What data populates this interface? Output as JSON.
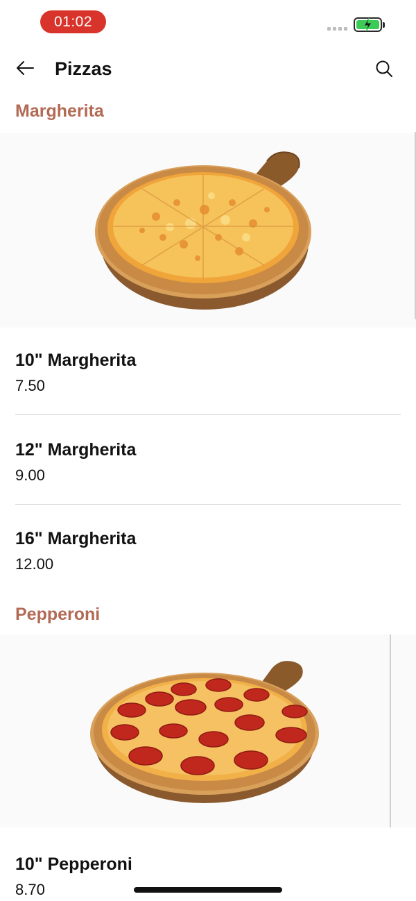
{
  "status_bar": {
    "time": "01:02",
    "time_pill_color": "#d8342c",
    "battery_color": "#3dcb57",
    "signal_icon": "signal-dots-icon",
    "battery_icon": "battery-charging-icon"
  },
  "header": {
    "title": "Pizzas",
    "back_icon": "arrow-left-icon",
    "search_icon": "search-icon"
  },
  "colors": {
    "category_title": "#b26a55",
    "divider": "#d4d4d4"
  },
  "categories": [
    {
      "title": "Margherita",
      "image": "margherita-pizza-image",
      "items": [
        {
          "name": "10\" Margherita",
          "price": "7.50"
        },
        {
          "name": "12\" Margherita",
          "price": "9.00"
        },
        {
          "name": "16\" Margherita",
          "price": "12.00"
        }
      ]
    },
    {
      "title": "Pepperoni",
      "image": "pepperoni-pizza-image",
      "items": [
        {
          "name": "10\" Pepperoni",
          "price": "8.70"
        }
      ]
    }
  ]
}
